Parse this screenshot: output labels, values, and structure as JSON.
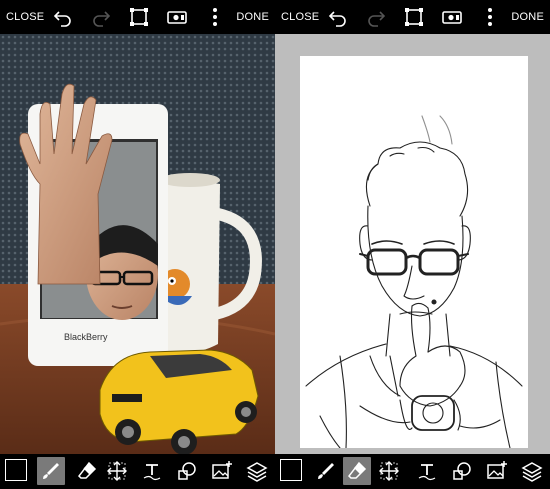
{
  "left_panel": {
    "toolbar": {
      "close_label": "CLOSE",
      "done_label": "DONE"
    },
    "photo": {
      "phone_brand": "BlackBerry"
    }
  },
  "right_panel": {
    "toolbar": {
      "close_label": "CLOSE",
      "done_label": "DONE"
    }
  },
  "colors": {
    "toolbar_bg": "#000000",
    "icon": "#ffffff",
    "active_tool_bg": "#7a7a7a",
    "canvas_bg": "#ffffff",
    "surround_bg": "#bdbdbd"
  },
  "tools": [
    "color-swatch",
    "brush",
    "eraser",
    "transform",
    "text",
    "shapes",
    "image",
    "layers"
  ],
  "active_tool": {
    "left": "brush",
    "right": "eraser"
  }
}
